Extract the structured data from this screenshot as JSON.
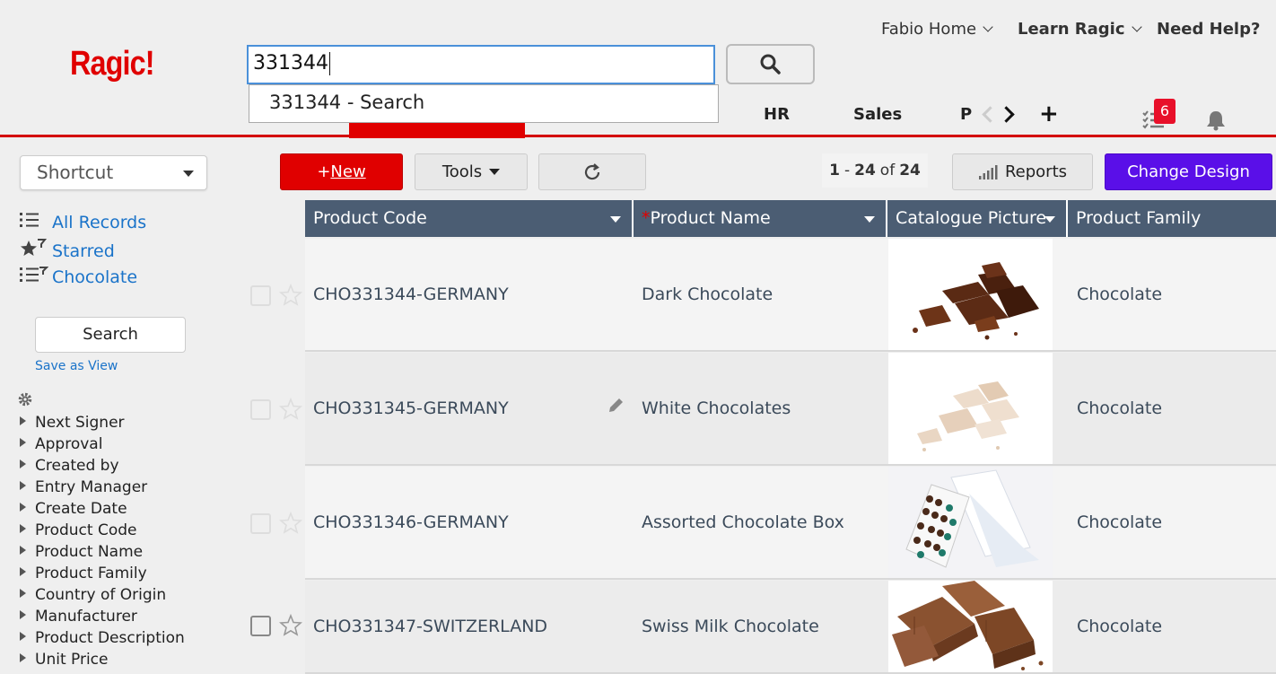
{
  "header": {
    "logo": "Ragic!",
    "search_value": "331344",
    "suggestion": "331344 - Search",
    "account_menu": "Fabio Home",
    "learn_menu": "Learn Ragic",
    "help_link": "Need Help?",
    "tabs": [
      "HR",
      "Sales",
      "P"
    ],
    "task_count": "6"
  },
  "sidebar": {
    "shortcut_label": "Shortcut",
    "views": [
      "All Records",
      "Starred",
      "Chocolate"
    ],
    "search_button": "Search",
    "save_view": "Save as View",
    "fields": [
      "Next Signer",
      "Approval",
      "Created by",
      "Entry Manager",
      "Create Date",
      "Product Code",
      "Product Name",
      "Product Family",
      "Country of Origin",
      "Manufacturer",
      "Product Description",
      "Unit Price"
    ]
  },
  "toolbar": {
    "new_prefix": "+",
    "new_label": "New",
    "tools_label": "Tools",
    "pager_start": "1",
    "pager_sep": "-",
    "pager_end": "24",
    "pager_of": "of",
    "pager_total": "24",
    "reports_label": "Reports",
    "design_label": "Change Design"
  },
  "table": {
    "columns": [
      "Product Code",
      "Product Name",
      "Catalogue Picture",
      "Product Family"
    ],
    "rows": [
      {
        "code": "CHO331344-GERMANY",
        "name": "Dark Chocolate",
        "family": "Chocolate",
        "picture": "dark-chocolate-image"
      },
      {
        "code": "CHO331345-GERMANY",
        "name": "White Chocolates",
        "family": "Chocolate",
        "picture": "white-chocolate-image"
      },
      {
        "code": "CHO331346-GERMANY",
        "name": "Assorted Chocolate Box",
        "family": "Chocolate",
        "picture": "chocolate-box-image"
      },
      {
        "code": "CHO331347-SWITZERLAND",
        "name": "Swiss Milk Chocolate",
        "family": "Chocolate",
        "picture": "milk-chocolate-image"
      }
    ]
  },
  "colors": {
    "brand_red": "#e00000",
    "header_bar": "#4b5d73",
    "design_purple": "#5a0fe8",
    "link_blue": "#1a73c9"
  }
}
